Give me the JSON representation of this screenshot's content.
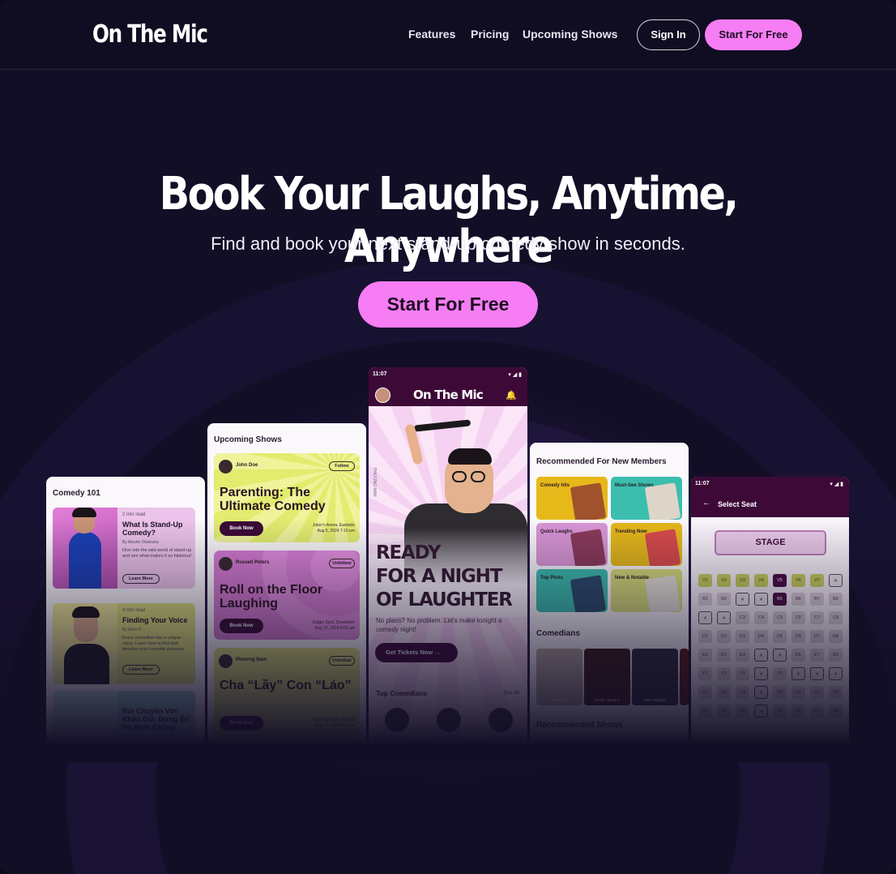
{
  "nav": {
    "logo": "On The Mic",
    "links": [
      "Features",
      "Pricing",
      "Upcoming Shows"
    ],
    "sign_in": "Sign In",
    "start_free": "Start For Free"
  },
  "hero": {
    "title": "Book Your Laughs, Anytime, Anywhere",
    "subtitle": "Find and book your next stand-up comedy show in seconds.",
    "cta": "Start For Free"
  },
  "colors": {
    "accent_pink": "#f67df4",
    "plum": "#3d0a38",
    "background": "#120e26"
  },
  "phones": {
    "comedy101": {
      "title": "Comedy 101",
      "articles": [
        {
          "meta": "2 min read",
          "title": "What Is Stand-Up Comedy?",
          "by": "By Atsuko Okatsuka",
          "desc": "Dive into the wild world of stand-up and see what makes it so hilarious!",
          "button": "Learn More"
        },
        {
          "meta": "4 min read",
          "title": "Finding Your Voice",
          "by": "By Minh Ti",
          "desc": "Every comedian has a unique voice. Learn how to find and develop your comedic persona.",
          "button": "Learn More"
        },
        {
          "meta": "",
          "title": "Nói Chuyện Với Khán Giả, Đừng Để Họ Ngồi Không",
          "by": "",
          "desc": "",
          "button": ""
        }
      ]
    },
    "upcoming": {
      "title": "Upcoming Shows",
      "shows": [
        {
          "name": "John Doe",
          "follow": "Follow",
          "title": "Parenting: The Ultimate Comedy",
          "venue": "Joker's Arena, Eastside",
          "date": "Aug 5, 2024 7:10 pm",
          "book": "Book Now"
        },
        {
          "name": "Russell Peters",
          "follow": "Unfollow",
          "title": "Roll on the Floor Laughing",
          "venue": "Giggle Spot, Downtown",
          "date": "Aug 12, 2024 8:01 am",
          "book": "Book Now"
        },
        {
          "name": "Phương Nam",
          "follow": "Unfollow",
          "title": "Cha “Lầy” Con “Láo”",
          "venue": "Hội Ông Khói, TP.HCM",
          "date": "Aug 14, 2024 9:00 pm",
          "book": "Book Now"
        }
      ]
    },
    "center": {
      "time": "11:07",
      "logo": "On The Mic",
      "side_label": "PHƯƠNG NAM",
      "headline_1": "READY",
      "headline_2": "FOR A NIGHT",
      "headline_3": "OF LAUGHTER",
      "body": "No plans? No problem. Let's make tonight a comedy night!",
      "button": "Get Tickets Now",
      "section": "Top Comedians",
      "see_all": "See all"
    },
    "recommended": {
      "title": "Recommended For New Members",
      "categories": [
        "Comedy hits",
        "Must-See Shows",
        "Quick Laughs",
        "Trending Now",
        "Top Picks",
        "New & Notable"
      ],
      "comedians_title": "Comedians",
      "comedians": [
        "Nick Lee",
        "Daniel Hamilton",
        "Mike Birbiglia"
      ],
      "shows_title": "Recommended Shows"
    },
    "seat": {
      "time": "11:07",
      "title": "Select Seat",
      "stage": "STAGE",
      "rows": [
        [
          "V1",
          "V2",
          "V3",
          "V4",
          "V5",
          "V6",
          "V7",
          "X"
        ],
        [
          "B1",
          "B2",
          "X",
          "X",
          "B5",
          "B6",
          "B7",
          "B8"
        ],
        [
          "X",
          "X",
          "C3",
          "C4",
          "C5",
          "C6",
          "C7",
          "C8"
        ],
        [
          "D1",
          "D2",
          "D3",
          "D4",
          "D5",
          "D6",
          "D7",
          "D8"
        ],
        [
          "E1",
          "E2",
          "E3",
          "X",
          "X",
          "E6",
          "E7",
          "E8"
        ],
        [
          "F1",
          "F2",
          "F3",
          "X",
          "F5",
          "X",
          "X",
          "X"
        ],
        [
          "G1",
          "G2",
          "G3",
          "X",
          "G5",
          "G6",
          "G7",
          "G8"
        ],
        [
          "E1",
          "E2",
          "E3",
          "X",
          "E5",
          "E6",
          "E7",
          "E8"
        ]
      ]
    }
  }
}
